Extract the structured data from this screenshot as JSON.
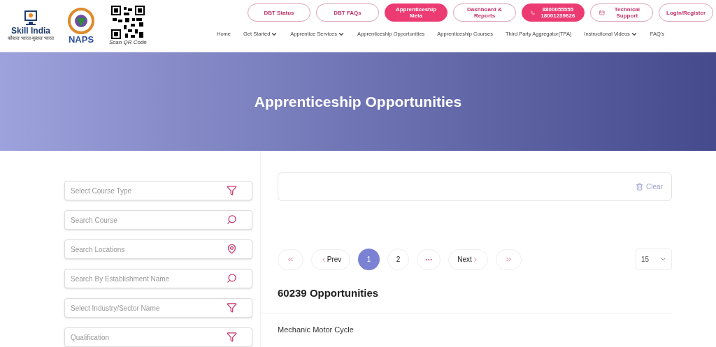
{
  "logos": {
    "skill_india": {
      "title": "Skill India",
      "tagline": "कौशल भारत-कुशल भारत"
    },
    "naps": {
      "title": "NAPS"
    },
    "qr": {
      "caption": "Scan QR Code"
    }
  },
  "top_buttons": [
    {
      "label": "DBT Status",
      "kind": "outline"
    },
    {
      "label": "DBT FAQs",
      "kind": "outline"
    },
    {
      "label": "Apprenticeship Mela",
      "kind": "filled"
    },
    {
      "label": "Dashboard & Reports",
      "kind": "outline"
    },
    {
      "label": "8800055555 18001239626",
      "kind": "phone"
    },
    {
      "label": "Technical Support",
      "kind": "mail"
    },
    {
      "label": "Login/Register",
      "kind": "dropdown"
    }
  ],
  "nav": [
    {
      "label": "Home",
      "has_dropdown": false
    },
    {
      "label": "Get Started",
      "has_dropdown": true
    },
    {
      "label": "Apprentice Services",
      "has_dropdown": true
    },
    {
      "label": "Apprenticeship Opportunities",
      "has_dropdown": false
    },
    {
      "label": "Apprenticeship Courses",
      "has_dropdown": false
    },
    {
      "label": "Third Party Aggregator(TPA)",
      "has_dropdown": false
    },
    {
      "label": "Instructional Videos",
      "has_dropdown": true
    },
    {
      "label": "FAQ's",
      "has_dropdown": false
    }
  ],
  "banner": {
    "title": "Apprenticeship Opportunities"
  },
  "filters": [
    {
      "placeholder": "Select Course Type",
      "kind": "filter"
    },
    {
      "placeholder": "Search Course",
      "kind": "search"
    },
    {
      "placeholder": "Search Locations",
      "kind": "location"
    },
    {
      "placeholder": "Search By Establishment Name",
      "kind": "search"
    },
    {
      "placeholder": "Select Industry/Sector Name",
      "kind": "filter"
    },
    {
      "placeholder": "Qualification",
      "kind": "filter"
    }
  ],
  "selection_box": {
    "clear": "Clear"
  },
  "pagination": {
    "prev": "Prev",
    "next": "Next",
    "pages": [
      {
        "label": "1",
        "selected": true
      },
      {
        "label": "2",
        "selected": false
      }
    ],
    "page_size": "15"
  },
  "result_count": "60239 Opportunities",
  "results": [
    "Mechanic Motor Cycle"
  ]
}
